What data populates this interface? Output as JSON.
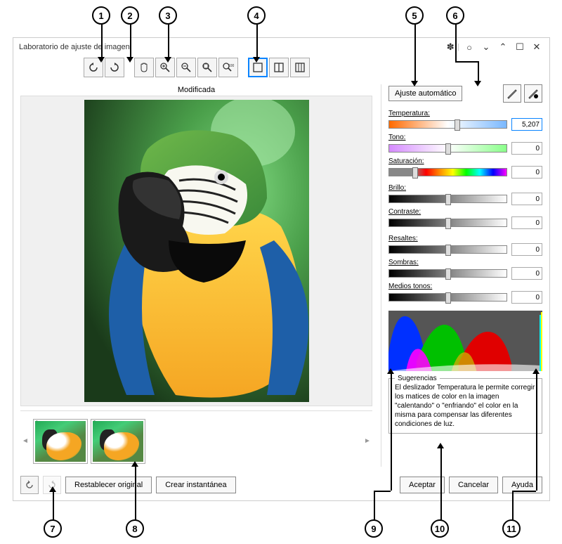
{
  "window": {
    "title": "Laboratorio de ajuste de imagen"
  },
  "toolbar": {
    "rotate_left": "↺",
    "rotate_right": "↻",
    "pan": "✋",
    "zoom_in": "+",
    "zoom_out": "−",
    "zoom_fit": "⊕",
    "zoom_100": "100",
    "view1": "☐",
    "view2": "◫",
    "view3": "▥"
  },
  "preview": {
    "label": "Modificada"
  },
  "thumbs": {
    "items": [
      {
        "n": "1"
      },
      {
        "n": "2"
      }
    ]
  },
  "right": {
    "auto_label": "Ajuste automático",
    "sliders": [
      {
        "key": "temperatura",
        "label": "Temperatura:",
        "value": "5,207",
        "grad": "grad-temp",
        "pos": 58,
        "active": true
      },
      {
        "key": "tono",
        "label": "Tono:",
        "value": "0",
        "grad": "grad-tone",
        "pos": 50
      },
      {
        "key": "saturacion",
        "label": "Saturación:",
        "value": "0",
        "grad": "grad-sat",
        "pos": 22
      },
      {
        "key": "brillo",
        "label": "Brillo:",
        "value": "0",
        "grad": "grad-gray",
        "pos": 50
      },
      {
        "key": "contraste",
        "label": "Contraste:",
        "value": "0",
        "grad": "grad-gray",
        "pos": 50
      },
      {
        "key": "resaltes",
        "label": "Resaltes:",
        "value": "0",
        "grad": "grad-gray",
        "pos": 50
      },
      {
        "key": "sombras",
        "label": "Sombras:",
        "value": "0",
        "grad": "grad-gray",
        "pos": 50
      },
      {
        "key": "medios",
        "label": "Medios tonos:",
        "value": "0",
        "grad": "grad-gray",
        "pos": 50
      }
    ],
    "hints_title": "Sugerencias",
    "hints_text": "El deslizador Temperatura le permite corregir los matices de color en la imagen \"calentando\" o \"enfriando\" el color en la misma para compensar las diferentes condiciones de luz."
  },
  "bottom": {
    "reset": "Restablecer original",
    "snapshot": "Crear instantánea",
    "ok": "Aceptar",
    "cancel": "Cancelar",
    "help": "Ayuda"
  },
  "callouts": [
    "1",
    "2",
    "3",
    "4",
    "5",
    "6",
    "7",
    "8",
    "9",
    "10",
    "11"
  ]
}
